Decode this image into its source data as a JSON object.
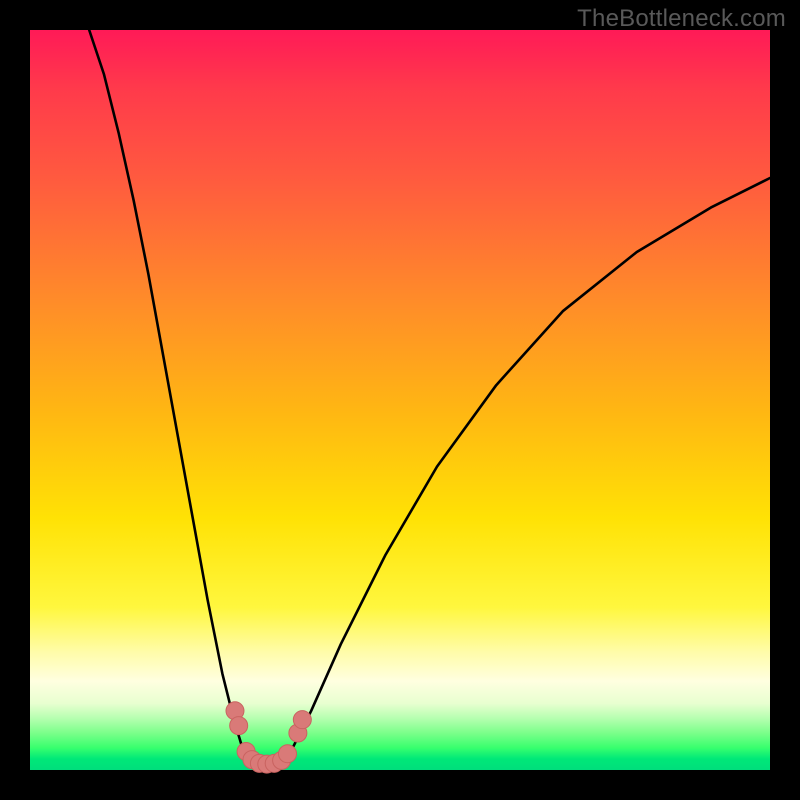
{
  "watermark": "TheBottleneck.com",
  "colors": {
    "frame": "#000000",
    "curve": "#000000",
    "marker_fill": "#d97a78",
    "marker_stroke": "#c96360",
    "gradient_top": "#ff1a57",
    "gradient_mid": "#ffe205",
    "gradient_bottom": "#00de7c"
  },
  "chart_data": {
    "type": "line",
    "title": "",
    "xlabel": "",
    "ylabel": "",
    "xlim": [
      0,
      100
    ],
    "ylim": [
      0,
      100
    ],
    "curve_left": {
      "x": [
        8,
        10,
        12,
        14,
        16,
        18,
        20,
        22,
        24,
        26,
        27.5,
        29
      ],
      "y": [
        100,
        94,
        86,
        77,
        67,
        56,
        45,
        34,
        23,
        13,
        7,
        2
      ]
    },
    "curve_right": {
      "x": [
        35,
        38,
        42,
        48,
        55,
        63,
        72,
        82,
        92,
        100
      ],
      "y": [
        2,
        8,
        17,
        29,
        41,
        52,
        62,
        70,
        76,
        80
      ]
    },
    "valley_floor": {
      "x": [
        29,
        30,
        31,
        32,
        33,
        34,
        35
      ],
      "y": [
        2,
        1,
        0.6,
        0.5,
        0.6,
        1,
        2
      ]
    },
    "markers": [
      {
        "x": 27.7,
        "y": 8.0
      },
      {
        "x": 28.2,
        "y": 6.0
      },
      {
        "x": 29.2,
        "y": 2.5
      },
      {
        "x": 30.0,
        "y": 1.4
      },
      {
        "x": 31.0,
        "y": 0.9
      },
      {
        "x": 32.0,
        "y": 0.8
      },
      {
        "x": 33.0,
        "y": 0.9
      },
      {
        "x": 34.0,
        "y": 1.3
      },
      {
        "x": 34.8,
        "y": 2.2
      },
      {
        "x": 36.2,
        "y": 5.0
      },
      {
        "x": 36.8,
        "y": 6.8
      }
    ]
  }
}
